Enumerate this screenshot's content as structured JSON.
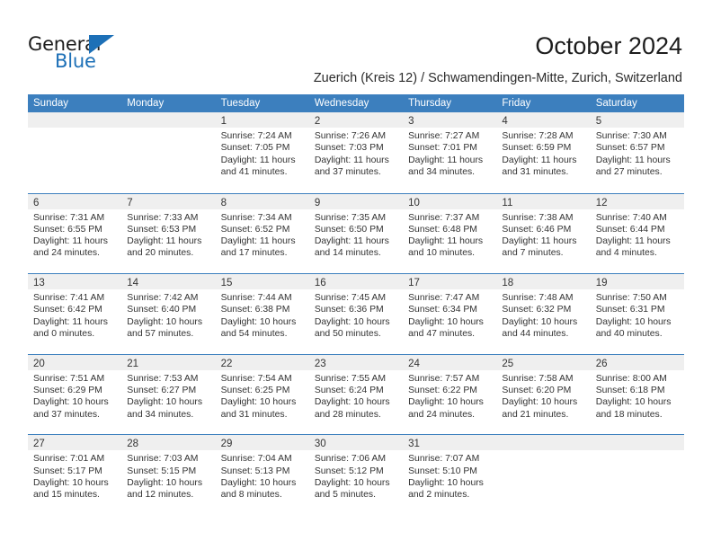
{
  "brand": {
    "name_top": "General",
    "name_bottom": "Blue",
    "accent_color": "#1d70b7"
  },
  "header": {
    "month_title": "October 2024",
    "location": "Zuerich (Kreis 12) / Schwamendingen-Mitte, Zurich, Switzerland"
  },
  "theme": {
    "header_blue": "#3c7fbe",
    "daynum_band": "#efefef",
    "cell_background": "#ffffff",
    "text": "#333333"
  },
  "weekdays": [
    "Sunday",
    "Monday",
    "Tuesday",
    "Wednesday",
    "Thursday",
    "Friday",
    "Saturday"
  ],
  "weeks": [
    [
      {
        "day": "",
        "lines": []
      },
      {
        "day": "",
        "lines": []
      },
      {
        "day": "1",
        "lines": [
          "Sunrise: 7:24 AM",
          "Sunset: 7:05 PM",
          "Daylight: 11 hours",
          "and 41 minutes."
        ]
      },
      {
        "day": "2",
        "lines": [
          "Sunrise: 7:26 AM",
          "Sunset: 7:03 PM",
          "Daylight: 11 hours",
          "and 37 minutes."
        ]
      },
      {
        "day": "3",
        "lines": [
          "Sunrise: 7:27 AM",
          "Sunset: 7:01 PM",
          "Daylight: 11 hours",
          "and 34 minutes."
        ]
      },
      {
        "day": "4",
        "lines": [
          "Sunrise: 7:28 AM",
          "Sunset: 6:59 PM",
          "Daylight: 11 hours",
          "and 31 minutes."
        ]
      },
      {
        "day": "5",
        "lines": [
          "Sunrise: 7:30 AM",
          "Sunset: 6:57 PM",
          "Daylight: 11 hours",
          "and 27 minutes."
        ]
      }
    ],
    [
      {
        "day": "6",
        "lines": [
          "Sunrise: 7:31 AM",
          "Sunset: 6:55 PM",
          "Daylight: 11 hours",
          "and 24 minutes."
        ]
      },
      {
        "day": "7",
        "lines": [
          "Sunrise: 7:33 AM",
          "Sunset: 6:53 PM",
          "Daylight: 11 hours",
          "and 20 minutes."
        ]
      },
      {
        "day": "8",
        "lines": [
          "Sunrise: 7:34 AM",
          "Sunset: 6:52 PM",
          "Daylight: 11 hours",
          "and 17 minutes."
        ]
      },
      {
        "day": "9",
        "lines": [
          "Sunrise: 7:35 AM",
          "Sunset: 6:50 PM",
          "Daylight: 11 hours",
          "and 14 minutes."
        ]
      },
      {
        "day": "10",
        "lines": [
          "Sunrise: 7:37 AM",
          "Sunset: 6:48 PM",
          "Daylight: 11 hours",
          "and 10 minutes."
        ]
      },
      {
        "day": "11",
        "lines": [
          "Sunrise: 7:38 AM",
          "Sunset: 6:46 PM",
          "Daylight: 11 hours",
          "and 7 minutes."
        ]
      },
      {
        "day": "12",
        "lines": [
          "Sunrise: 7:40 AM",
          "Sunset: 6:44 PM",
          "Daylight: 11 hours",
          "and 4 minutes."
        ]
      }
    ],
    [
      {
        "day": "13",
        "lines": [
          "Sunrise: 7:41 AM",
          "Sunset: 6:42 PM",
          "Daylight: 11 hours",
          "and 0 minutes."
        ]
      },
      {
        "day": "14",
        "lines": [
          "Sunrise: 7:42 AM",
          "Sunset: 6:40 PM",
          "Daylight: 10 hours",
          "and 57 minutes."
        ]
      },
      {
        "day": "15",
        "lines": [
          "Sunrise: 7:44 AM",
          "Sunset: 6:38 PM",
          "Daylight: 10 hours",
          "and 54 minutes."
        ]
      },
      {
        "day": "16",
        "lines": [
          "Sunrise: 7:45 AM",
          "Sunset: 6:36 PM",
          "Daylight: 10 hours",
          "and 50 minutes."
        ]
      },
      {
        "day": "17",
        "lines": [
          "Sunrise: 7:47 AM",
          "Sunset: 6:34 PM",
          "Daylight: 10 hours",
          "and 47 minutes."
        ]
      },
      {
        "day": "18",
        "lines": [
          "Sunrise: 7:48 AM",
          "Sunset: 6:32 PM",
          "Daylight: 10 hours",
          "and 44 minutes."
        ]
      },
      {
        "day": "19",
        "lines": [
          "Sunrise: 7:50 AM",
          "Sunset: 6:31 PM",
          "Daylight: 10 hours",
          "and 40 minutes."
        ]
      }
    ],
    [
      {
        "day": "20",
        "lines": [
          "Sunrise: 7:51 AM",
          "Sunset: 6:29 PM",
          "Daylight: 10 hours",
          "and 37 minutes."
        ]
      },
      {
        "day": "21",
        "lines": [
          "Sunrise: 7:53 AM",
          "Sunset: 6:27 PM",
          "Daylight: 10 hours",
          "and 34 minutes."
        ]
      },
      {
        "day": "22",
        "lines": [
          "Sunrise: 7:54 AM",
          "Sunset: 6:25 PM",
          "Daylight: 10 hours",
          "and 31 minutes."
        ]
      },
      {
        "day": "23",
        "lines": [
          "Sunrise: 7:55 AM",
          "Sunset: 6:24 PM",
          "Daylight: 10 hours",
          "and 28 minutes."
        ]
      },
      {
        "day": "24",
        "lines": [
          "Sunrise: 7:57 AM",
          "Sunset: 6:22 PM",
          "Daylight: 10 hours",
          "and 24 minutes."
        ]
      },
      {
        "day": "25",
        "lines": [
          "Sunrise: 7:58 AM",
          "Sunset: 6:20 PM",
          "Daylight: 10 hours",
          "and 21 minutes."
        ]
      },
      {
        "day": "26",
        "lines": [
          "Sunrise: 8:00 AM",
          "Sunset: 6:18 PM",
          "Daylight: 10 hours",
          "and 18 minutes."
        ]
      }
    ],
    [
      {
        "day": "27",
        "lines": [
          "Sunrise: 7:01 AM",
          "Sunset: 5:17 PM",
          "Daylight: 10 hours",
          "and 15 minutes."
        ]
      },
      {
        "day": "28",
        "lines": [
          "Sunrise: 7:03 AM",
          "Sunset: 5:15 PM",
          "Daylight: 10 hours",
          "and 12 minutes."
        ]
      },
      {
        "day": "29",
        "lines": [
          "Sunrise: 7:04 AM",
          "Sunset: 5:13 PM",
          "Daylight: 10 hours",
          "and 8 minutes."
        ]
      },
      {
        "day": "30",
        "lines": [
          "Sunrise: 7:06 AM",
          "Sunset: 5:12 PM",
          "Daylight: 10 hours",
          "and 5 minutes."
        ]
      },
      {
        "day": "31",
        "lines": [
          "Sunrise: 7:07 AM",
          "Sunset: 5:10 PM",
          "Daylight: 10 hours",
          "and 2 minutes."
        ]
      },
      {
        "day": "",
        "lines": []
      },
      {
        "day": "",
        "lines": []
      }
    ]
  ]
}
